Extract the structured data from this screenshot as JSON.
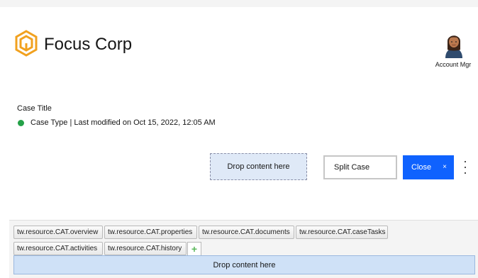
{
  "header": {
    "brand": "Focus Corp",
    "logo_icon": "hexagon-logo-icon",
    "brand_color": "#f1a11f",
    "account_label": "Account Mgr",
    "avatar_icon": "user-avatar-icon"
  },
  "case": {
    "title": "Case Title",
    "meta": "Case Type | Last modified on Oct 15, 2022, 12:05 AM",
    "status_color": "#24a148"
  },
  "actions": {
    "drop_label": "Drop content here",
    "split_label": "Split Case",
    "close_label": "Close",
    "close_x": "×",
    "accent": "#0f62fe",
    "overflow_icon": "overflow-menu-vertical-icon"
  },
  "tabs": [
    {
      "label": "tw.resource.CAT.overview"
    },
    {
      "label": "tw.resource.CAT.properties"
    },
    {
      "label": "tw.resource.CAT.documents"
    },
    {
      "label": "tw.resource.CAT.caseTasks"
    },
    {
      "label": "tw.resource.CAT.activities"
    },
    {
      "label": "tw.resource.CAT.history"
    }
  ],
  "add_tab": {
    "label": "+",
    "icon": "add-tab-icon"
  },
  "bottom_drop": {
    "label": "Drop content here"
  }
}
